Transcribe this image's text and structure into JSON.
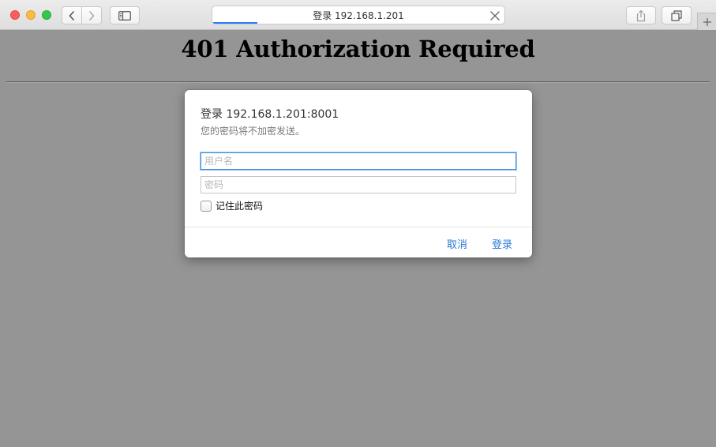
{
  "window": {
    "tab_title": "登录 192.168.1.201",
    "accent": "#2d7cf6"
  },
  "page": {
    "heading": "401 Authorization Required",
    "background": "#959595"
  },
  "dialog": {
    "title": "登录 192.168.1.201:8001",
    "subtitle": "您的密码将不加密发送。",
    "username_placeholder": "用户名",
    "username_value": "",
    "password_placeholder": "密码",
    "password_value": "",
    "remember_label": "记住此密码",
    "remember_checked": false,
    "cancel_label": "取消",
    "login_label": "登录",
    "button_color": "#2a7ad6"
  },
  "icons": {
    "back": "chevron-left-icon",
    "forward": "chevron-right-icon",
    "sidebar": "sidebar-icon",
    "share": "share-icon",
    "tabs": "tab-overview-icon",
    "close_tab": "close-icon",
    "new_tab": "plus-icon"
  }
}
